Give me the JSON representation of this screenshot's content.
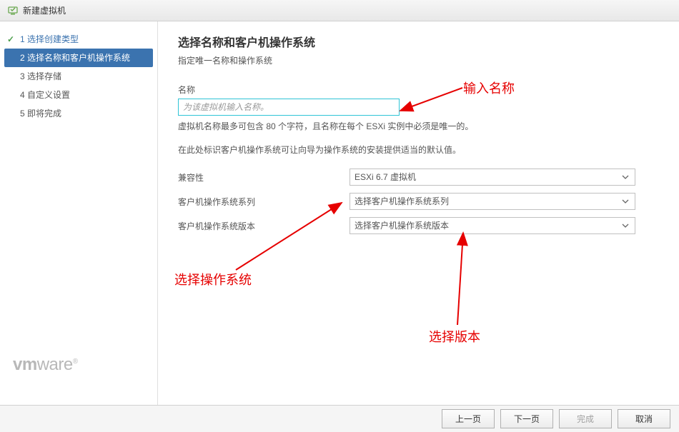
{
  "window": {
    "title": "新建虚拟机"
  },
  "sidebar": {
    "steps": [
      {
        "label": "1 选择创建类型"
      },
      {
        "label": "2 选择名称和客户机操作系统"
      },
      {
        "label": "3 选择存储"
      },
      {
        "label": "4 自定义设置"
      },
      {
        "label": "5 即将完成"
      }
    ]
  },
  "mainpanel": {
    "heading": "选择名称和客户机操作系统",
    "subdesc": "指定唯一名称和操作系统",
    "name_label": "名称",
    "name_placeholder": "为该虚拟机输入名称。",
    "name_hint": "虚拟机名称最多可包含 80 个字符，且名称在每个 ESXi 实例中必须是唯一的。",
    "guest_hint": "在此处标识客户机操作系统可让向导为操作系统的安装提供适当的默认值。",
    "rows": {
      "compat": {
        "label": "兼容性",
        "value": "ESXi 6.7 虚拟机"
      },
      "family": {
        "label": "客户机操作系统系列",
        "value": "选择客户机操作系统系列"
      },
      "version": {
        "label": "客户机操作系统版本",
        "value": "选择客户机操作系统版本"
      }
    }
  },
  "footer": {
    "back": "上一页",
    "next": "下一页",
    "finish": "完成",
    "cancel": "取消"
  },
  "annotations": {
    "a1": "输入名称",
    "a2": "选择操作系统",
    "a3": "选择版本"
  }
}
